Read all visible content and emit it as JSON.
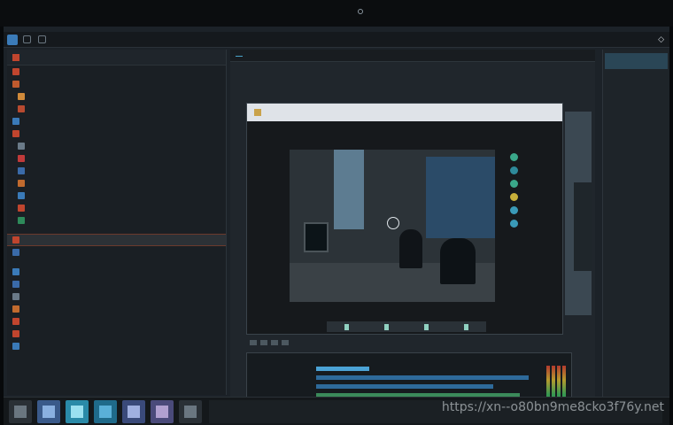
{
  "colors": {
    "accent": "#4aa3c8",
    "selection_border": "#6b3a2c",
    "timeline_bar": "#2e6a9a",
    "timeline_bar_highlight": "#4ba3d6"
  },
  "watermark": "https://xn--o80bn9me8cko3f76y.net"
}
